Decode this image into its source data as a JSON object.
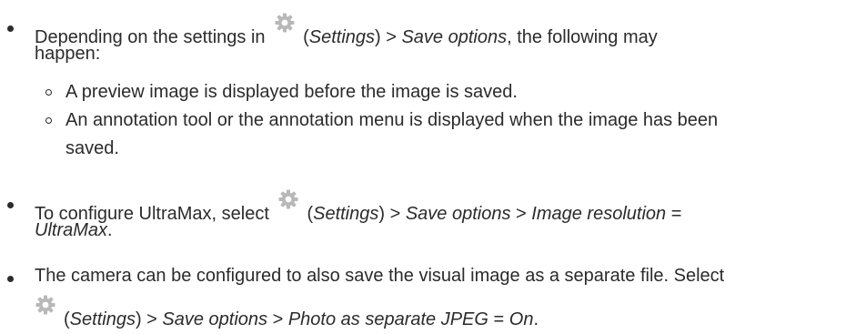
{
  "items": [
    {
      "pre": "Depending on the settings in ",
      "link1": "Settings",
      "mid": ") > ",
      "link2": "Save options",
      "post": ", the following may",
      "line2": "happen:",
      "subitems": [
        {
          "line1": "A preview image is displayed before the image is saved."
        },
        {
          "line1": "An annotation tool or the annotation menu is displayed when the image has been",
          "line2": "saved."
        }
      ]
    },
    {
      "pre": "To configure UltraMax, select ",
      "link1": "Settings",
      "mid": ") > ",
      "link2": "Save options",
      "sep": " > ",
      "link3": "Image resolution",
      "eq": " =",
      "line2": "UltraMax",
      "end": "."
    },
    {
      "line1": "The camera can be configured to also save the visual image as a separate file. Select",
      "link1": "Settings",
      "mid": ") > ",
      "link2": "Save options",
      "sep": " > ",
      "link3": "Photo as separate JPEG",
      "eq": " = ",
      "link4": "On",
      "end": "."
    }
  ],
  "icons": {
    "settings": "gear-icon",
    "gear_color": "#b8b8b8"
  },
  "colors": {
    "text": "#2b2b2b",
    "background": "#ffffff"
  }
}
